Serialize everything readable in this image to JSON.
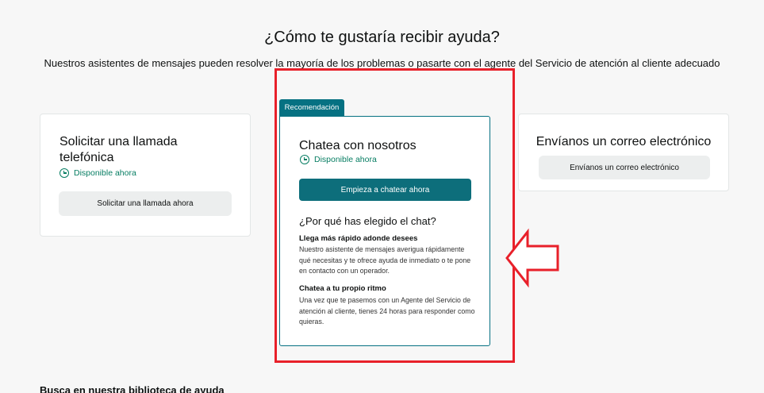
{
  "header": {
    "title": "¿Cómo te gustaría recibir ayuda?",
    "subtitle": "Nuestros asistentes de mensajes pueden resolver la mayoría de los problemas o pasarte con el agente del Servicio de atención al cliente adecuado"
  },
  "call_card": {
    "title": "Solicitar una llamada telefónica",
    "availability": "Disponible ahora",
    "button_label": "Solicitar una llamada ahora"
  },
  "chat_card": {
    "tag": "Recomendación",
    "title": "Chatea con nosotros",
    "availability": "Disponible ahora",
    "button_label": "Empieza a chatear ahora",
    "why_heading": "¿Por qué has elegido el chat?",
    "reasons": [
      {
        "title": "Llega más rápido adonde desees",
        "text": "Nuestro asistente de mensajes averigua rápidamente qué necesitas y te ofrece ayuda de inmediato o te pone en contacto con un operador."
      },
      {
        "title": "Chatea a tu propio ritmo",
        "text": "Una vez que te pasemos con un Agente del Servicio de atención al cliente, tienes 24 horas para responder como quieras."
      }
    ]
  },
  "email_card": {
    "title": "Envíanos un correo electrónico",
    "button_label": "Envíanos un correo electrónico"
  },
  "library": {
    "heading": "Busca en nuestra biblioteca de ayuda"
  },
  "icons": {
    "availability": "clock-icon",
    "annotation": "left-arrow-icon"
  },
  "colors": {
    "background": "#f7f7f7",
    "teal": "#067182",
    "available_green": "#067d62",
    "annotation_red": "#e8202a"
  }
}
